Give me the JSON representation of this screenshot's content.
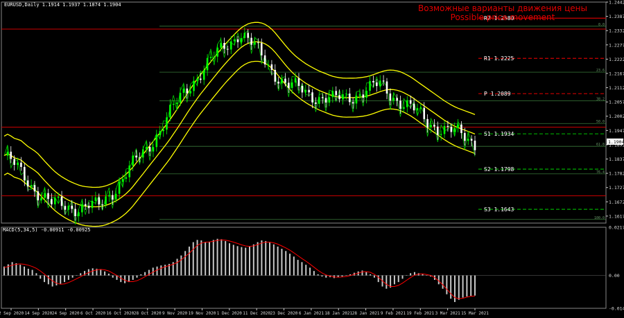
{
  "header": {
    "symbol_line": "EURUSD,Daily  1.1914 1.1937 1.1874 1.1904",
    "watermark_ru": "Возможные варианты движения цены",
    "watermark_en": "Possible price movement"
  },
  "colors": {
    "background": "#000000",
    "bull_candle": "#00ff00",
    "bear_candle": "#ffffff",
    "bollinger": "#ffff00",
    "close_line": "#00cc00",
    "pivot_red": "#cc0000",
    "pivot_green": "#00aa00",
    "fib_lines": "#3a7a3a",
    "macd_hist": "#c8c8c8",
    "macd_signal": "#ff0000",
    "watermark": "#e00000"
  },
  "chart_data": [
    {
      "type": "candlestick",
      "title": "EURUSD,Daily  1.1914 1.1937 1.1874 1.1904",
      "ylim": [
        1.159,
        1.2442
      ],
      "price_axis_ticks": [
        "1.2442",
        "1.2387",
        "1.2332",
        "1.2277",
        "1.2222",
        "1.2167",
        "1.2112",
        "1.2057",
        "1.2002",
        "1.1947",
        "1.1892",
        "1.1837",
        "1.1782",
        "1.1727",
        "1.1672",
        "1.1617"
      ],
      "current_price": "1.1904",
      "date_axis_ticks": [
        "2 Sep 2020",
        "14 Sep 2020",
        "24 Sep 2020",
        "6 Oct 2020",
        "16 Oct 2020",
        "28 Oct 2020",
        "9 Nov 2020",
        "19 Nov 2020",
        "1 Dec 2020",
        "11 Dec 2020",
        "23 Dec 2020",
        "6 Jan 2021",
        "18 Jan 2021",
        "28 Jan 2021",
        "9 Feb 2021",
        "19 Feb 2021",
        "3 Mar 2021",
        "15 Mar 2021"
      ],
      "key_closes": [
        {
          "date": "2 Sep 2020",
          "close": 1.185
        },
        {
          "date": "24 Sep 2020",
          "close": 1.166
        },
        {
          "date": "28 Oct 2020",
          "close": 1.165
        },
        {
          "date": "19 Nov 2020",
          "close": 1.187
        },
        {
          "date": "11 Dec 2020",
          "close": 1.214
        },
        {
          "date": "6 Jan 2021",
          "close": 1.233
        },
        {
          "date": "28 Jan 2021",
          "close": 1.212
        },
        {
          "date": "9 Feb 2021",
          "close": 1.206
        },
        {
          "date": "19 Feb 2021",
          "close": 1.212
        },
        {
          "date": "3 Mar 2021",
          "close": 1.198
        },
        {
          "date": "15 Mar 2021",
          "close": 1.1904
        }
      ],
      "levels": [
        {
          "name": "R2",
          "label": "R2 1.2380",
          "value": 1.238,
          "color": "#cc0000",
          "style": "solid"
        },
        {
          "name": "R1",
          "label": "R1 1.2225",
          "value": 1.2225,
          "color": "#cc0000",
          "style": "dashed"
        },
        {
          "name": "P",
          "label": "P 1.2089",
          "value": 1.2089,
          "color": "#cc0000",
          "style": "dashed"
        },
        {
          "name": "S1",
          "label": "S1 1.1934",
          "value": 1.1934,
          "color": "#00aa00",
          "style": "dashed"
        },
        {
          "name": "S2",
          "label": "S2 1.1798",
          "value": 1.1798,
          "color": "#00aa00",
          "style": "dashed"
        },
        {
          "name": "S3",
          "label": "S3 1.1643",
          "value": 1.1643,
          "color": "#00aa00",
          "style": "dashed"
        }
      ],
      "fib_levels": [
        {
          "label": "0.0",
          "value": 1.2349
        },
        {
          "label": "23.6",
          "value": 1.2172
        },
        {
          "label": "38.2",
          "value": 1.2061
        },
        {
          "label": "50.0",
          "value": 1.1974
        },
        {
          "label": "61.8",
          "value": 1.1886
        },
        {
          "label": "76.4",
          "value": 1.178
        },
        {
          "label": "100.0",
          "value": 1.1604
        }
      ],
      "red_horizontal_levels": [
        1.2338,
        1.196,
        1.1695
      ]
    },
    {
      "type": "bar",
      "title": "MACD(5,34,5) -0.00911 -0.00925",
      "ylim": [
        -0.01483,
        0.02172
      ],
      "axis_ticks": [
        "0.02172",
        "0.00",
        "-0.01483"
      ],
      "series": [
        {
          "name": "MACD",
          "values": [
            0.004,
            0.005,
            0.006,
            0.0055,
            0.0048,
            0.004,
            0.003,
            0.0025,
            0.001,
            -0.0015,
            -0.003,
            -0.004,
            -0.005,
            -0.0045,
            -0.0038,
            -0.003,
            -0.002,
            -0.001,
            0.0,
            0.001,
            0.002,
            0.0028,
            0.0032,
            0.003,
            0.0025,
            0.0018,
            0.0008,
            -0.001,
            -0.002,
            -0.003,
            -0.0035,
            -0.003,
            -0.002,
            -0.001,
            0.0005,
            0.0015,
            0.0025,
            0.0035,
            0.004,
            0.0045,
            0.0048,
            0.0052,
            0.006,
            0.0075,
            0.009,
            0.011,
            0.013,
            0.015,
            0.016,
            0.0158,
            0.015,
            0.0152,
            0.016,
            0.0165,
            0.0163,
            0.0155,
            0.0145,
            0.0138,
            0.0132,
            0.0128,
            0.0125,
            0.013,
            0.014,
            0.015,
            0.0158,
            0.0155,
            0.0148,
            0.014,
            0.013,
            0.012,
            0.011,
            0.0098,
            0.0085,
            0.007,
            0.006,
            0.0048,
            0.0035,
            0.002,
            0.0005,
            -0.0005,
            -0.001,
            -0.0008,
            -0.0012,
            -0.0008,
            -0.0005,
            0.0,
            0.0005,
            0.0012,
            0.0018,
            0.0022,
            0.0015,
            0.0005,
            -0.001,
            -0.003,
            -0.005,
            -0.006,
            -0.0055,
            -0.004,
            -0.003,
            -0.0015,
            0.0,
            0.001,
            0.0015,
            0.001,
            0.0005,
            0.0,
            -0.0005,
            -0.002,
            -0.004,
            -0.006,
            -0.0085,
            -0.0105,
            -0.012,
            -0.011,
            -0.01,
            -0.0095,
            -0.0092,
            -0.0091
          ]
        },
        {
          "name": "Signal",
          "values": [
            0.0035,
            0.004,
            0.0046,
            0.005,
            0.0052,
            0.005,
            0.0046,
            0.004,
            0.0032,
            0.002,
            0.0006,
            -0.001,
            -0.0025,
            -0.0035,
            -0.004,
            -0.0038,
            -0.0032,
            -0.0024,
            -0.0015,
            -0.0006,
            0.0004,
            0.0013,
            0.002,
            0.0025,
            0.0027,
            0.0025,
            0.002,
            0.001,
            0.0,
            -0.0012,
            -0.0022,
            -0.0028,
            -0.0028,
            -0.0024,
            -0.0016,
            -0.0006,
            0.0005,
            0.0015,
            0.0024,
            0.0032,
            0.0039,
            0.0044,
            0.005,
            0.0058,
            0.007,
            0.0085,
            0.01,
            0.0118,
            0.0135,
            0.0146,
            0.015,
            0.0151,
            0.0154,
            0.0158,
            0.016,
            0.0159,
            0.0155,
            0.015,
            0.0144,
            0.0138,
            0.0133,
            0.0131,
            0.0133,
            0.0139,
            0.0146,
            0.015,
            0.015,
            0.0147,
            0.0141,
            0.0133,
            0.0124,
            0.0114,
            0.0102,
            0.0089,
            0.0076,
            0.0064,
            0.0051,
            0.0037,
            0.0023,
            0.0011,
            0.0002,
            -0.0003,
            -0.0007,
            -0.0008,
            -0.0007,
            -0.0005,
            -0.0001,
            0.0005,
            0.001,
            0.0016,
            0.0017,
            0.0014,
            0.0005,
            -0.0008,
            -0.0025,
            -0.004,
            -0.005,
            -0.005,
            -0.0045,
            -0.0035,
            -0.0022,
            -0.001,
            0.0001,
            0.0006,
            0.0007,
            0.0004,
            0.0,
            -0.001,
            -0.0025,
            -0.0042,
            -0.0062,
            -0.0082,
            -0.01,
            -0.0105,
            -0.0103,
            -0.0098,
            -0.0094,
            -0.0093
          ]
        }
      ]
    }
  ]
}
